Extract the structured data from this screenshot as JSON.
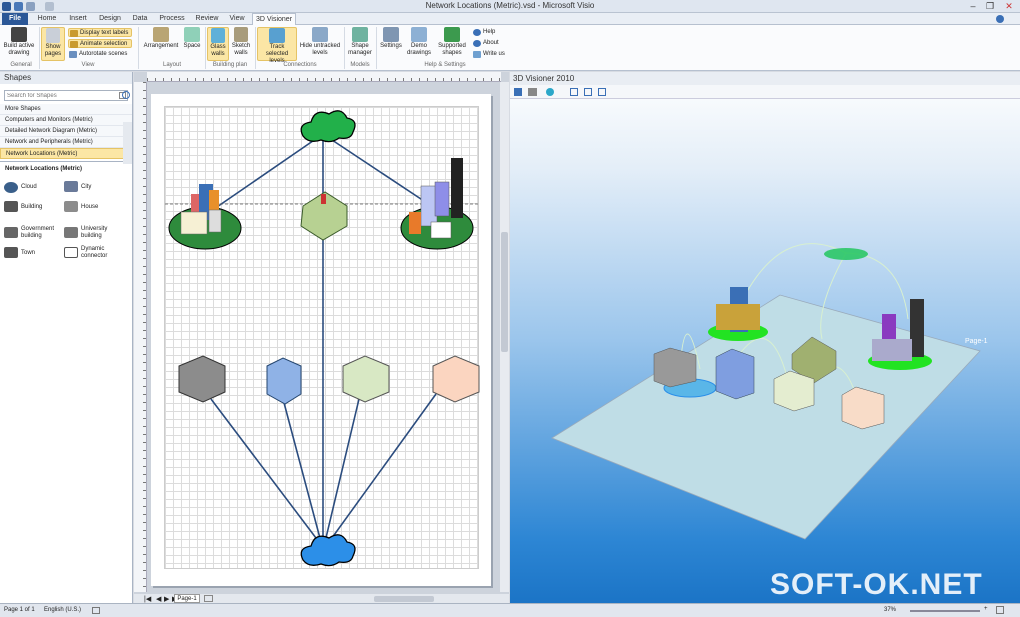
{
  "titlebar": {
    "title": "Network Locations (Metric).vsd - Microsoft Visio"
  },
  "tabs": [
    "File",
    "Home",
    "Insert",
    "Design",
    "Data",
    "Process",
    "Review",
    "View",
    "3D Visioner"
  ],
  "ribbon": {
    "build_drawing": "Build active drawing",
    "show_pages": "Show pages",
    "display_text_labels": "Display text labels",
    "animate_selection": "Animate selection",
    "autorotate_scenes": "Autorotate scenes",
    "arrangement": "Arrangement",
    "space": "Space",
    "glass_walls": "Glass walls",
    "sketch_walls": "Sketch walls",
    "track_selected_levels": "Track selected levels",
    "hide_untracked_levels": "Hide untracked levels",
    "shape_manager": "Shape manager",
    "settings": "Settings",
    "demo_drawings": "Demo drawings",
    "supported_shapes": "Supported shapes",
    "help": "Help",
    "about": "About",
    "write_us": "Write us",
    "groups": {
      "general": "General",
      "view": "View",
      "layout": "Layout",
      "building_plan": "Building plan",
      "connections": "Connections",
      "models": "Models",
      "help_settings": "Help & Settings"
    }
  },
  "shapes_panel": {
    "title": "Shapes",
    "search_placeholder": "Search for Shapes",
    "stencils": [
      "More Shapes",
      "Computers and Monitors (Metric)",
      "Detailed Network Diagram (Metric)",
      "Network and Peripherals (Metric)",
      "Network Locations (Metric)"
    ],
    "active_stencil": "Network Locations (Metric)",
    "masters": [
      {
        "label": "Cloud"
      },
      {
        "label": "City"
      },
      {
        "label": "Building"
      },
      {
        "label": "House"
      },
      {
        "label": "Government building"
      },
      {
        "label": "University building"
      },
      {
        "label": "Town"
      },
      {
        "label": "Dynamic connector"
      }
    ]
  },
  "page_tab": "Page-1",
  "viewer": {
    "title": "3D Visioner 2010",
    "page_label": "Page-1"
  },
  "status": {
    "page": "Page 1 of 1",
    "language": "English (U.S.)",
    "zoom": "37%"
  },
  "watermark": "SOFT-OK.NET",
  "colors": {
    "file_tab": "#2b5797",
    "highlight": "#fbe6a5",
    "ground": "#2e8b3c",
    "cloud_top": "#22c55e",
    "cloud_bottom": "#2c8fe8"
  }
}
